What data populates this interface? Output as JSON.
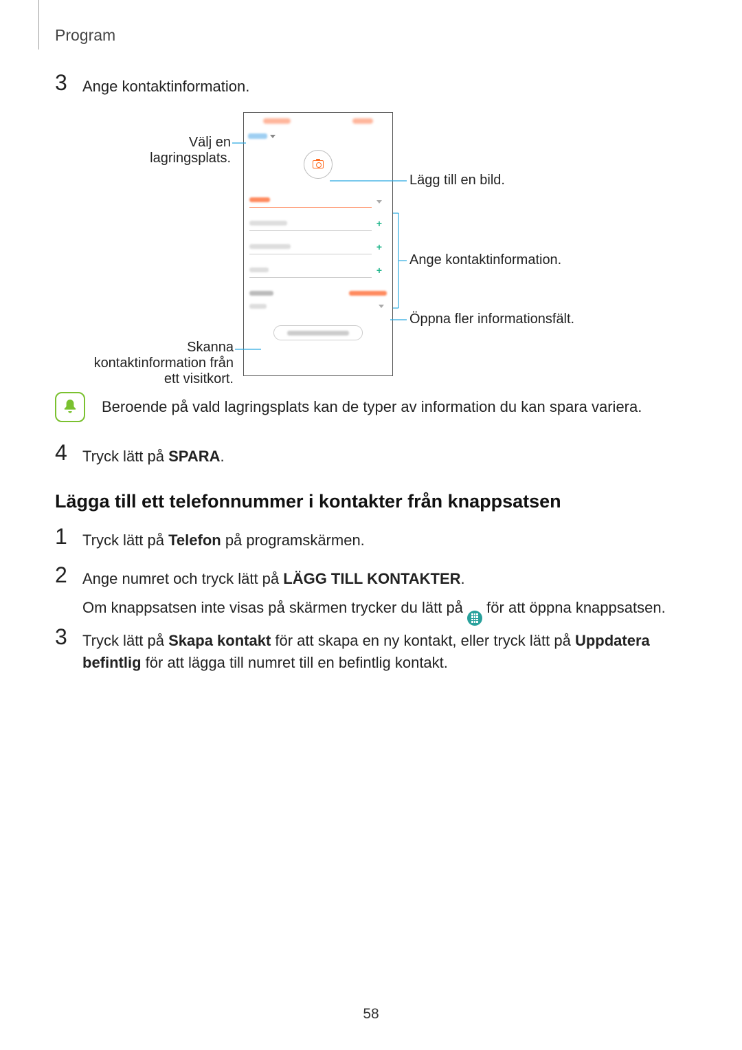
{
  "header": "Program",
  "page_number": "58",
  "step3": {
    "num": "3",
    "text": "Ange kontaktinformation."
  },
  "step4": {
    "num": "4",
    "pre": "Tryck lätt på ",
    "bold": "SPARA",
    "post": "."
  },
  "callouts": {
    "storage": "Välj en lagringsplats.",
    "scan": "Skanna kontaktinformation från ett visitkort.",
    "image": "Lägg till en bild.",
    "info": "Ange kontaktinformation.",
    "more": "Öppna fler informationsfält."
  },
  "note": "Beroende på vald lagringsplats kan de typer av information du kan spara variera.",
  "subheading": "Lägga till ett telefonnummer i kontakter från knappsatsen",
  "b1": {
    "num": "1",
    "pre": "Tryck lätt på ",
    "bold": "Telefon",
    "post": " på programskärmen."
  },
  "b2": {
    "num": "2",
    "line1_pre": "Ange numret och tryck lätt på ",
    "line1_bold": "LÄGG TILL KONTAKTER",
    "line1_post": ".",
    "line2_pre": "Om knappsatsen inte visas på skärmen trycker du lätt på ",
    "line2_post": " för att öppna knappsatsen."
  },
  "b3": {
    "num": "3",
    "p1": "Tryck lätt på ",
    "b1": "Skapa kontakt",
    "p2": " för att skapa en ny kontakt, eller tryck lätt på ",
    "b2": "Uppdatera befintlig",
    "p3": " för att lägga till numret till en befintlig kontakt."
  }
}
